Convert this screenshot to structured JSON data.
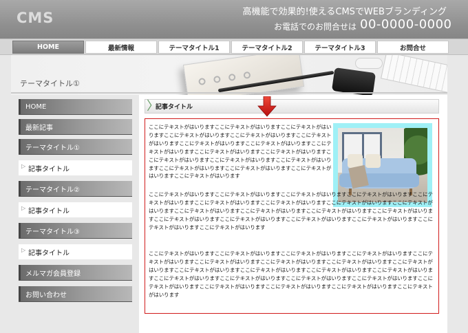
{
  "header": {
    "logo": "CMS",
    "tagline": "高機能で効果的!使えるCMSでWEBブランディング",
    "contact_label": "お電話でのお問合せは",
    "phone": "00-0000-0000"
  },
  "nav": {
    "items": [
      {
        "label": "HOME",
        "active": true
      },
      {
        "label": "最新情報",
        "active": false
      },
      {
        "label": "テーマタイトル1",
        "active": false
      },
      {
        "label": "テーマタイトル2",
        "active": false
      },
      {
        "label": "テーマタイトル3",
        "active": false
      },
      {
        "label": "お問合せ",
        "active": false
      }
    ]
  },
  "hero": {
    "title": "テーマタイトル①"
  },
  "sidebar": {
    "items": [
      {
        "label": "HOME",
        "type": "button"
      },
      {
        "label": "最新記事",
        "type": "button"
      },
      {
        "label": "テーマタイトル①",
        "type": "button"
      },
      {
        "label": "記事タイトル",
        "type": "sub"
      },
      {
        "label": "テーマタイトル②",
        "type": "button"
      },
      {
        "label": "記事タイトル",
        "type": "sub"
      },
      {
        "label": "テーマタイトル③",
        "type": "button"
      },
      {
        "label": "記事タイトル",
        "type": "sub"
      },
      {
        "label": "メルマガ会員登録",
        "type": "button"
      },
      {
        "label": "お問い合わせ",
        "type": "button"
      }
    ]
  },
  "main": {
    "section_title": "記事タイトル",
    "paragraphs": [
      "ここにテキストがはいりますここにテキストがはいりますここにテキストがはいりますここにテキストがはいりますここにテキストがはいりますここにテキストがはいりますここにテキストがはいりますここにテキストがはいりますここにテキストがはいりますここにテキストがはいりますここにテキストがはいりますここにテキストがはいりますここにテキストがはいりますここにテキストがはいりますここにテキストがはいりますここにテキストがはいりますここにテキストがはいりますここにテキストがはいります",
      "ここにテキストがはいりますここにテキストがはいりますここにテキストがはいりますここにテキストがはいりますここにテキストがはいりますここにテキストがはいりますここにテキストがはいりますここにテキストがはいりますここにテキストがはいりますここにテキストがはいりますここにテキストがはいりますここにテキストがはいりますここにテキストがはいりますここにテキストがはいりますここにテキストがはいりますここにテキストがはいりますここにテキストがはいりますここにテキストがはいりますここにテキストがはいります",
      "ここにテキストがはいりますここにテキストがはいりますここにテキストがはいりますここにテキストがはいりますここにテキストがはいりますここにテキストがはいりますここにテキストがはいりますここにテキストがはいりますここにテキストがはいりますここにテキストがはいりますここにテキストがはいりますここにテキストがはいりますここにテキストがはいりますここにテキストがはいりますここにテキストがはいりますここにテキストがはいりますここにテキストがはいりますここにテキストがはいりますここにテキストがはいりますここにテキストがはいりますここにテキストがはいりますここにテキストがはいります"
    ]
  },
  "colors": {
    "content_border": "#d01a1a",
    "photo_frame": "#9ff0f6",
    "arrow": "#d42020",
    "section_chevron": "#6aa06a"
  },
  "icons": {
    "section_marker": "chevron-right-icon",
    "pointer": "down-arrow-icon",
    "sub_item": "triangle-right-icon"
  }
}
